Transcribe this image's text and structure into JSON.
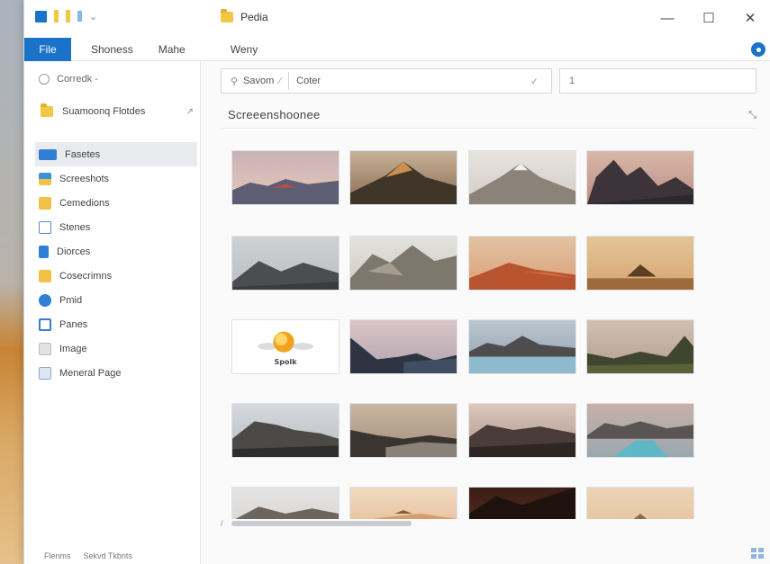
{
  "window": {
    "title": "Pedia",
    "controls": {
      "minimize": "—",
      "maximize": "☐",
      "close": "✕"
    }
  },
  "ribbon": {
    "tabs": [
      {
        "label": "File"
      },
      {
        "label": "Shoness"
      },
      {
        "label": "Mahe"
      },
      {
        "label": "Weny"
      }
    ]
  },
  "sidebar": {
    "recent_label": "Corredk -",
    "folder_label": "Suamoonq Flotdes",
    "items": [
      {
        "label": "Fasetes",
        "icon": "pictures-icon",
        "color": "#2f7fd6"
      },
      {
        "label": "Screeshots",
        "icon": "downloads-icon",
        "color": "#3e8fd9"
      },
      {
        "label": "Cemedions",
        "icon": "documents-icon",
        "color": "#f1c248"
      },
      {
        "label": "Stenes",
        "icon": "desktop-icon",
        "color": "#5a87c7"
      },
      {
        "label": "Diorces",
        "icon": "drive-icon",
        "color": "#2f7fd6"
      },
      {
        "label": "Cosecrimns",
        "icon": "folder-icon",
        "color": "#f1c248"
      },
      {
        "label": "Pmid",
        "icon": "globe-icon",
        "color": "#2f7fd6"
      },
      {
        "label": "Panes",
        "icon": "gallery-icon",
        "color": "#3b7cc9"
      },
      {
        "label": "Image",
        "icon": "image-icon",
        "color": "#bbbbbb"
      },
      {
        "label": "Meneral Page",
        "icon": "page-icon",
        "color": "#8fa8c8"
      }
    ],
    "status": [
      "Flenms",
      "Sekvd Tkbnts"
    ]
  },
  "toolbar": {
    "address_prefix": "Savom",
    "address_value": "Coter",
    "search_value": "1"
  },
  "content": {
    "folder_title": "Screeenshoonee",
    "thumbnails": [
      {
        "name": "thumbnail-1",
        "kind": "dusk-range"
      },
      {
        "name": "thumbnail-2",
        "kind": "golden-peak"
      },
      {
        "name": "thumbnail-3",
        "kind": "misty-peak"
      },
      {
        "name": "thumbnail-4",
        "kind": "dark-crags"
      },
      {
        "name": "thumbnail-5",
        "kind": "grey-range"
      },
      {
        "name": "thumbnail-6",
        "kind": "rocky-ridges"
      },
      {
        "name": "thumbnail-7",
        "kind": "red-desert"
      },
      {
        "name": "thumbnail-8",
        "kind": "desert-pyramid"
      },
      {
        "name": "thumbnail-9",
        "kind": "logo"
      },
      {
        "name": "thumbnail-10",
        "kind": "valley-dusk"
      },
      {
        "name": "thumbnail-11",
        "kind": "lake-mountains"
      },
      {
        "name": "thumbnail-12",
        "kind": "green-valley"
      },
      {
        "name": "thumbnail-13",
        "kind": "grey-hills"
      },
      {
        "name": "thumbnail-14",
        "kind": "river-valley"
      },
      {
        "name": "thumbnail-15",
        "kind": "misty-hills"
      },
      {
        "name": "thumbnail-16",
        "kind": "river-mountains"
      },
      {
        "name": "thumbnail-17",
        "kind": "pale-hills"
      },
      {
        "name": "thumbnail-18",
        "kind": "peach-horizon"
      },
      {
        "name": "thumbnail-19",
        "kind": "dark-cliff"
      },
      {
        "name": "thumbnail-20",
        "kind": "sand-dune"
      }
    ],
    "logo_text": "Spolk"
  },
  "colors": {
    "accent": "#1a73c9",
    "folder": "#f2c744"
  }
}
